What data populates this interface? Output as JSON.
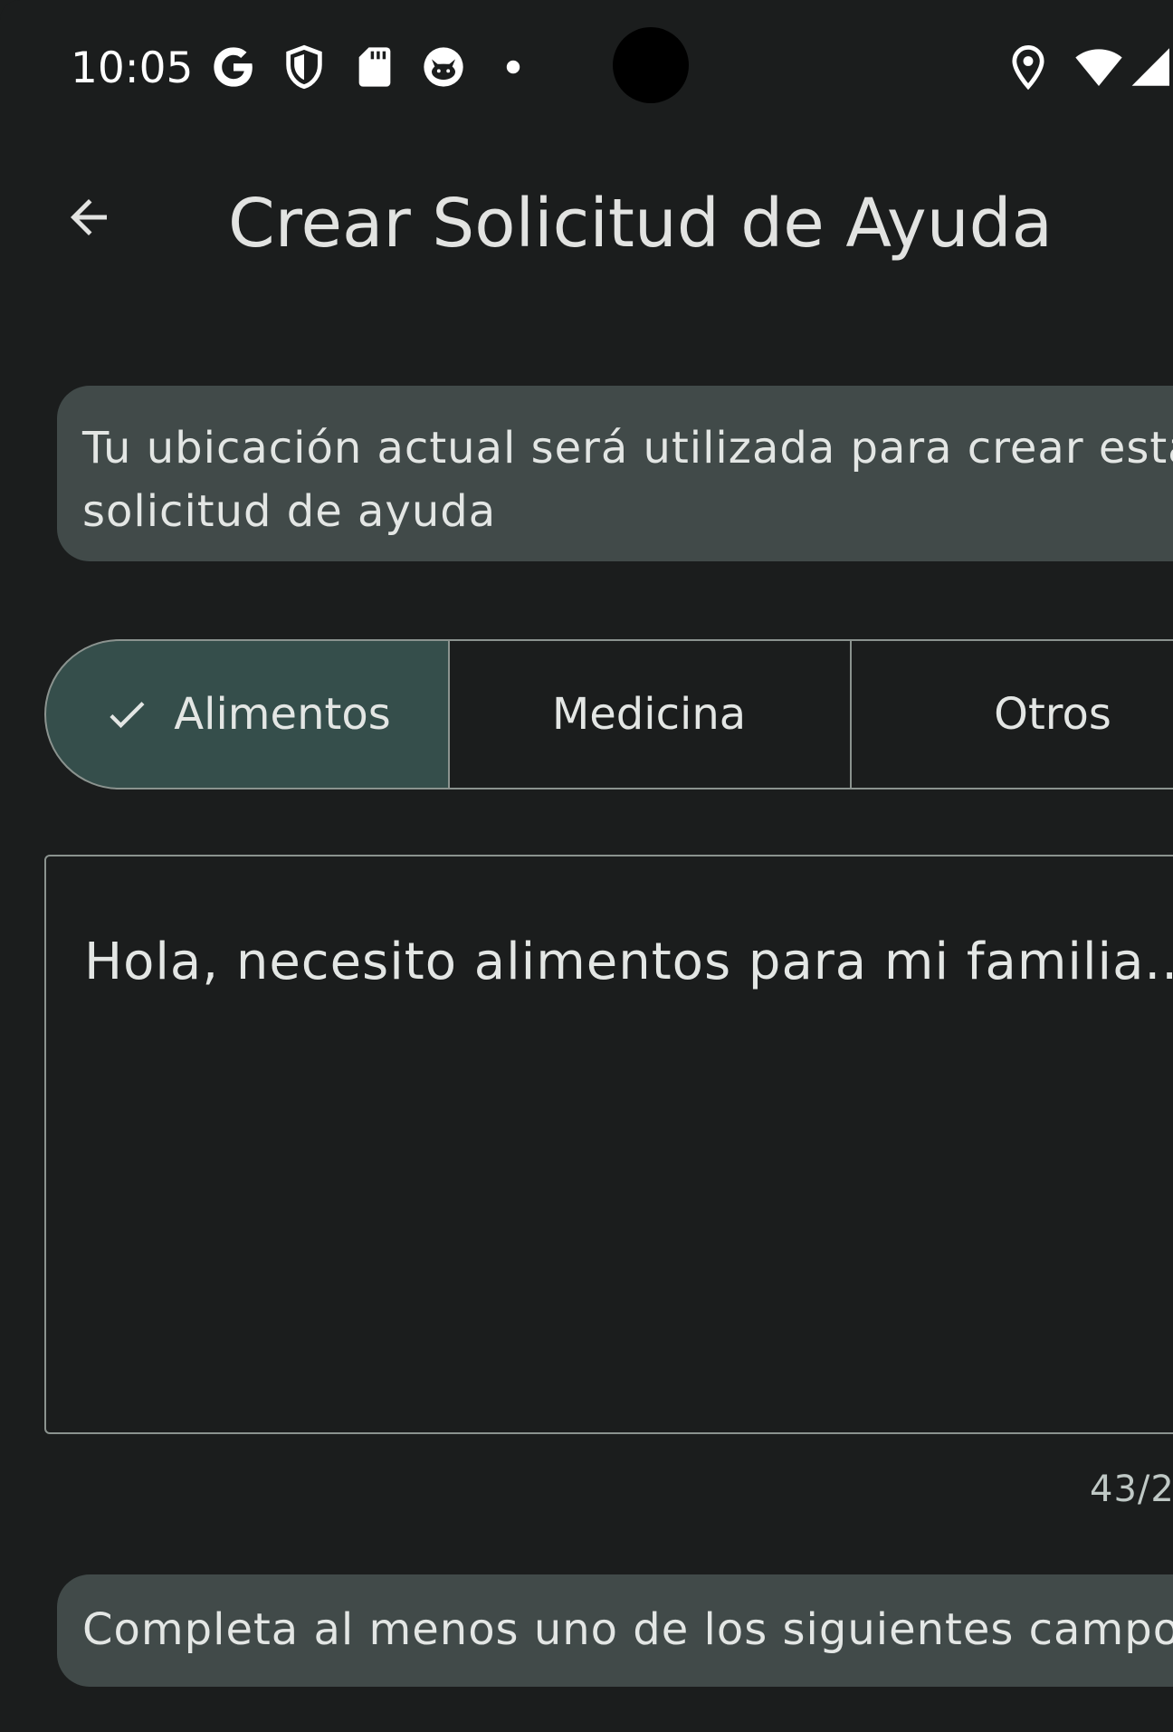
{
  "status_bar": {
    "time": "10:05",
    "icons": [
      "google-icon",
      "shield-icon",
      "sd-card-icon",
      "cat-icon",
      "notification-dot-icon",
      "location-icon",
      "wifi-icon",
      "cell-signal-icon"
    ]
  },
  "app_bar": {
    "title": "Crear Solicitud de Ayuda",
    "back_icon": "arrow-back-icon"
  },
  "info_card": {
    "text": "Tu ubicación actual será utilizada para crear esta solicitud de ayuda"
  },
  "categories": {
    "selected": "Alimentos",
    "items": [
      {
        "label": "Alimentos",
        "selected": true
      },
      {
        "label": "Medicina",
        "selected": false
      },
      {
        "label": "Otros",
        "selected": false
      }
    ]
  },
  "message_field": {
    "value": "Hola, necesito alimentos para mi familia...",
    "counter": "43/2"
  },
  "hint": {
    "text": "Completa al menos uno de los siguientes campos"
  },
  "colors": {
    "background": "#1b1d1d",
    "card": "#414a49",
    "selected_segment": "#354e4b",
    "outline": "#8b938f",
    "text": "#e3e6e4"
  }
}
